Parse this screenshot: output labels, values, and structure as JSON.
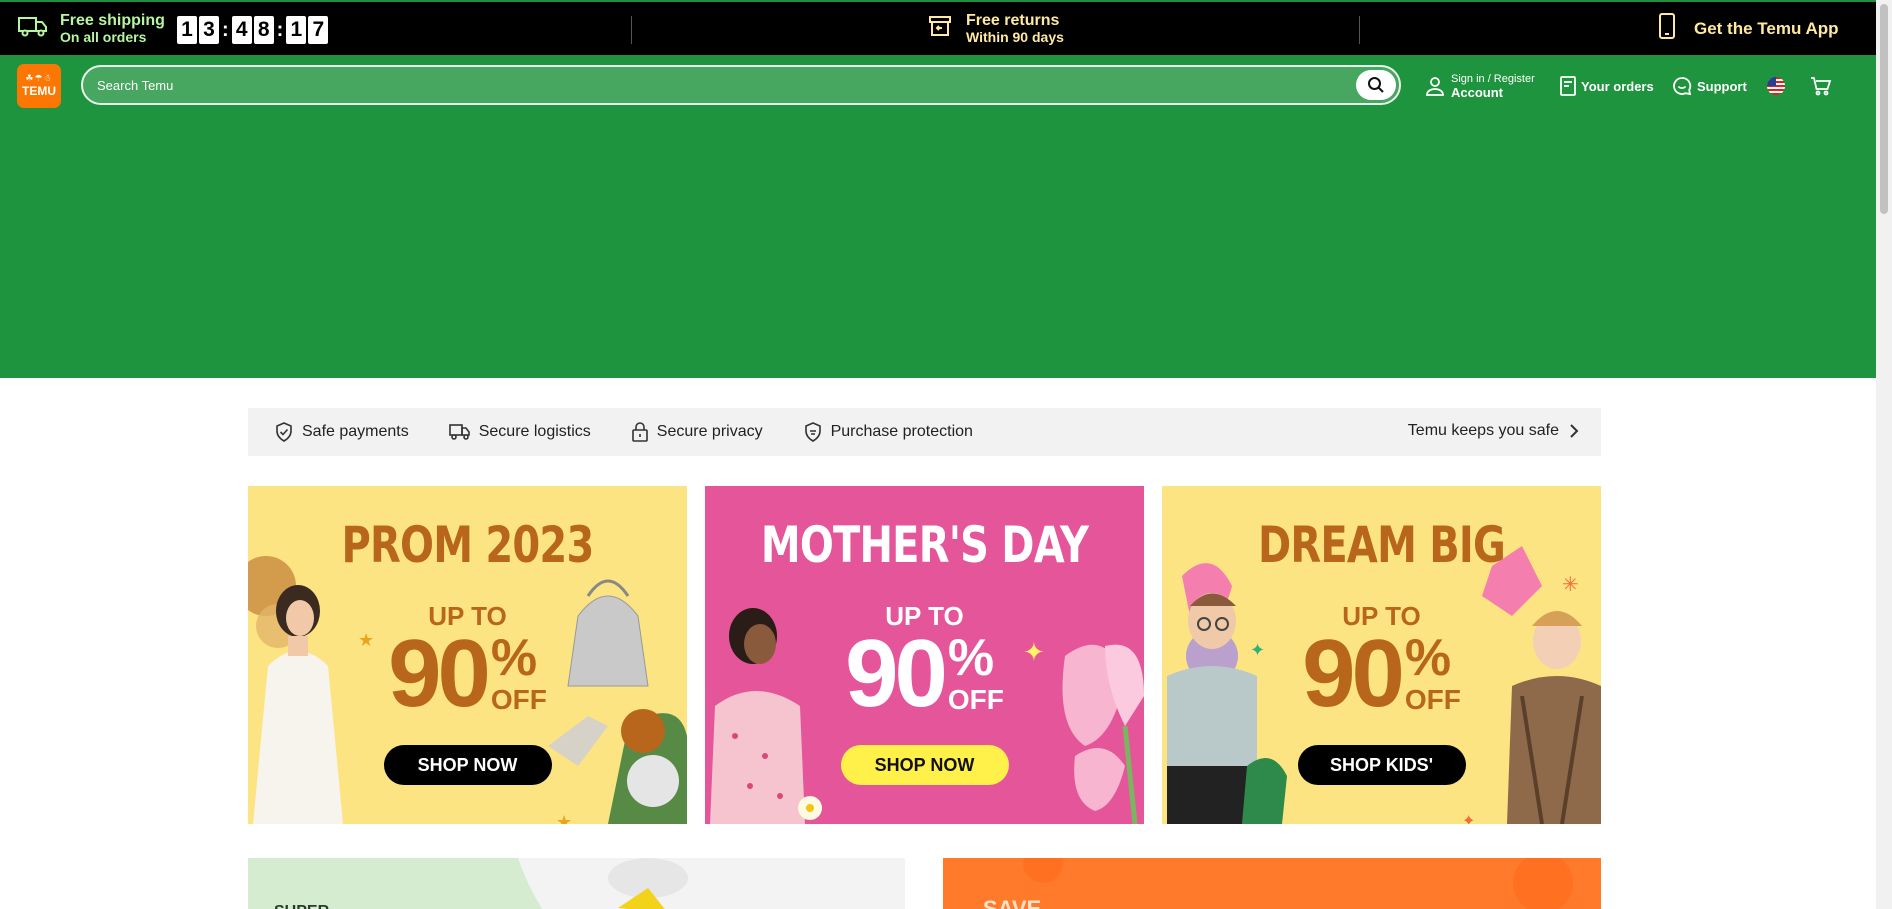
{
  "topbar": {
    "shipping": {
      "title": "Free shipping",
      "subtitle": "On all orders"
    },
    "countdown": [
      "1",
      "3",
      "4",
      "8",
      "1",
      "7"
    ],
    "returns": {
      "title": "Free returns",
      "subtitle": "Within 90 days"
    },
    "app": {
      "label": "Get the Temu App"
    }
  },
  "header": {
    "logo_top": "☘☂☃",
    "logo_bottom": "TEMU",
    "search_placeholder": "Search Temu",
    "account_small": "Sign in / Register",
    "account_big": "Account",
    "orders": "Your orders",
    "support": "Support"
  },
  "safebar": {
    "items": [
      "Safe payments",
      "Secure logistics",
      "Secure privacy",
      "Purchase protection"
    ],
    "keeps": "Temu keeps you safe"
  },
  "cards": [
    {
      "head": "PROM 2023",
      "upto": "UP TO",
      "num": "90",
      "pct": "%",
      "off": "OFF",
      "button": "SHOP NOW"
    },
    {
      "head": "MOTHER'S DAY",
      "upto": "UP TO",
      "num": "90",
      "pct": "%",
      "off": "OFF",
      "button": "SHOP NOW"
    },
    {
      "head": "DREAM BIG",
      "upto": "UP TO",
      "num": "90",
      "pct": "%",
      "off": "OFF",
      "button": "SHOP KIDS'"
    }
  ],
  "colors": {
    "brand_green": "#1d943d",
    "brand_orange": "#fb7701",
    "card_yellow": "#fde482",
    "card_pink": "#e55599"
  }
}
